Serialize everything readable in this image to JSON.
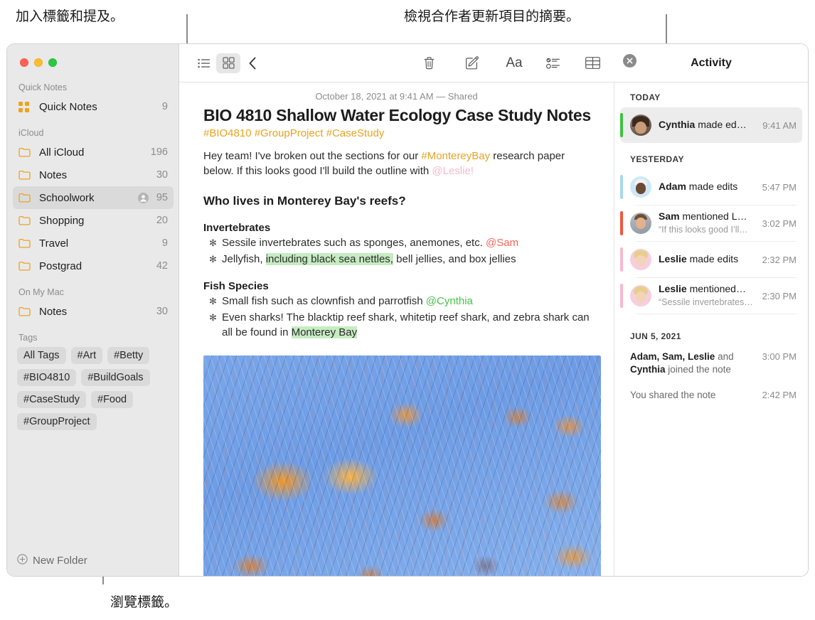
{
  "annotations": {
    "top_left": "加入標籤和提及。",
    "top_right": "檢視合作者更新項目的摘要。",
    "bottom_left": "瀏覽標籤。"
  },
  "sidebar": {
    "sections": [
      {
        "title": "Quick Notes",
        "rows": [
          {
            "icon": "quick-notes-icon",
            "label": "Quick Notes",
            "count": "9",
            "shared": false,
            "selected": false
          }
        ]
      },
      {
        "title": "iCloud",
        "rows": [
          {
            "icon": "folder-icon",
            "label": "All iCloud",
            "count": "196",
            "shared": false,
            "selected": false
          },
          {
            "icon": "folder-icon",
            "label": "Notes",
            "count": "30",
            "shared": false,
            "selected": false
          },
          {
            "icon": "folder-icon",
            "label": "Schoolwork",
            "count": "95",
            "shared": true,
            "selected": true
          },
          {
            "icon": "folder-icon",
            "label": "Shopping",
            "count": "20",
            "shared": false,
            "selected": false
          },
          {
            "icon": "folder-icon",
            "label": "Travel",
            "count": "9",
            "shared": false,
            "selected": false
          },
          {
            "icon": "folder-icon",
            "label": "Postgrad",
            "count": "42",
            "shared": false,
            "selected": false
          }
        ]
      },
      {
        "title": "On My Mac",
        "rows": [
          {
            "icon": "folder-icon",
            "label": "Notes",
            "count": "30",
            "shared": false,
            "selected": false
          }
        ]
      }
    ],
    "tags_title": "Tags",
    "tags": [
      "All Tags",
      "#Art",
      "#Betty",
      "#BIO4810",
      "#BuildGoals",
      "#CaseStudy",
      "#Food",
      "#GroupProject"
    ],
    "new_folder_label": "New Folder"
  },
  "toolbar": {
    "list_view": "list-view-icon",
    "gallery_view": "gallery-view-icon",
    "back": "back-chevron-icon",
    "delete": "trash-icon",
    "compose": "compose-icon",
    "format": "Aa",
    "checklist": "checklist-icon",
    "table": "table-icon",
    "link": "add-link-icon",
    "lock": "lock-icon",
    "media": "media-icon",
    "collaborate": "collaborate-icon",
    "share": "share-icon",
    "search": "search-icon"
  },
  "note": {
    "date": "October 18, 2021 at 9:41 AM — Shared",
    "title": "BIO 4810 Shallow Water Ecology Case Study Notes",
    "tags": "#BIO4810 #GroupProject #CaseStudy",
    "intro": {
      "part1": "Hey team! I've broken out the sections for our ",
      "mention_bay": "#MontereyBay",
      "part2": " research paper below. If this looks good I'll build the outline with ",
      "mention_leslie": "@Leslie!"
    },
    "heading": "Who lives in Monterey Bay's reefs?",
    "groups": [
      {
        "subheading": "Invertebrates",
        "items": [
          {
            "pre": "Sessile invertebrates such as sponges, anemones, etc. ",
            "mention": "@Sam",
            "mention_color": "red",
            "post": "",
            "highlight": "",
            "tail": ""
          },
          {
            "pre": "Jellyfish, ",
            "mention": "",
            "mention_color": "",
            "highlight": "including black sea nettles,",
            "tail": " bell jellies, and box jellies",
            "post": ""
          }
        ]
      },
      {
        "subheading": "Fish Species",
        "items": [
          {
            "pre": "Small fish such as clownfish and parrotfish ",
            "mention": "@Cynthia",
            "mention_color": "green",
            "post": "",
            "highlight": "",
            "tail": ""
          },
          {
            "pre": "Even sharks! The blacktip reef shark, whitetip reef shark, and zebra shark can all be found in ",
            "mention": "",
            "mention_color": "",
            "highlight": "Monterey Bay",
            "tail": "",
            "post": ""
          }
        ]
      }
    ],
    "photo_alt": "jellyfish-photo"
  },
  "activity": {
    "title": "Activity",
    "close": "close-icon",
    "groups": [
      {
        "day": "TODAY",
        "items": [
          {
            "avatar": "av-cynthia",
            "bar_color": "#3ec13e",
            "name": "Cynthia",
            "action": " made ed…",
            "quote": "",
            "time": "9:41 AM",
            "selected": true
          }
        ]
      },
      {
        "day": "YESTERDAY",
        "items": [
          {
            "avatar": "av-adam",
            "bar_color": "#a8d8f0",
            "name": "Adam",
            "action": " made edits",
            "quote": "",
            "time": "5:47 PM",
            "selected": false
          },
          {
            "avatar": "av-sam",
            "bar_color": "#f2553d",
            "name": "Sam",
            "action": " mentioned L…",
            "quote": "“If this looks good I’ll…",
            "time": "3:02 PM",
            "selected": false
          },
          {
            "avatar": "av-leslie",
            "bar_color": "#f9b8cd",
            "name": "Leslie",
            "action": " made edits",
            "quote": "",
            "time": "2:32 PM",
            "selected": false
          },
          {
            "avatar": "av-leslie",
            "bar_color": "#f9b8cd",
            "name": "Leslie",
            "action": " mentioned…",
            "quote": "“Sessile invertebrates…",
            "time": "2:30 PM",
            "selected": false
          }
        ]
      }
    ],
    "older": {
      "day": "JUN 5, 2021",
      "entries": [
        {
          "bold1": "Adam, Sam, Leslie",
          "mid": " and ",
          "bold2": "Cynthia",
          "rest": " joined the note",
          "time": "3:00 PM"
        },
        {
          "bold1": "",
          "mid": "",
          "bold2": "",
          "rest": "You shared the note",
          "time": "2:42 PM"
        }
      ]
    }
  }
}
